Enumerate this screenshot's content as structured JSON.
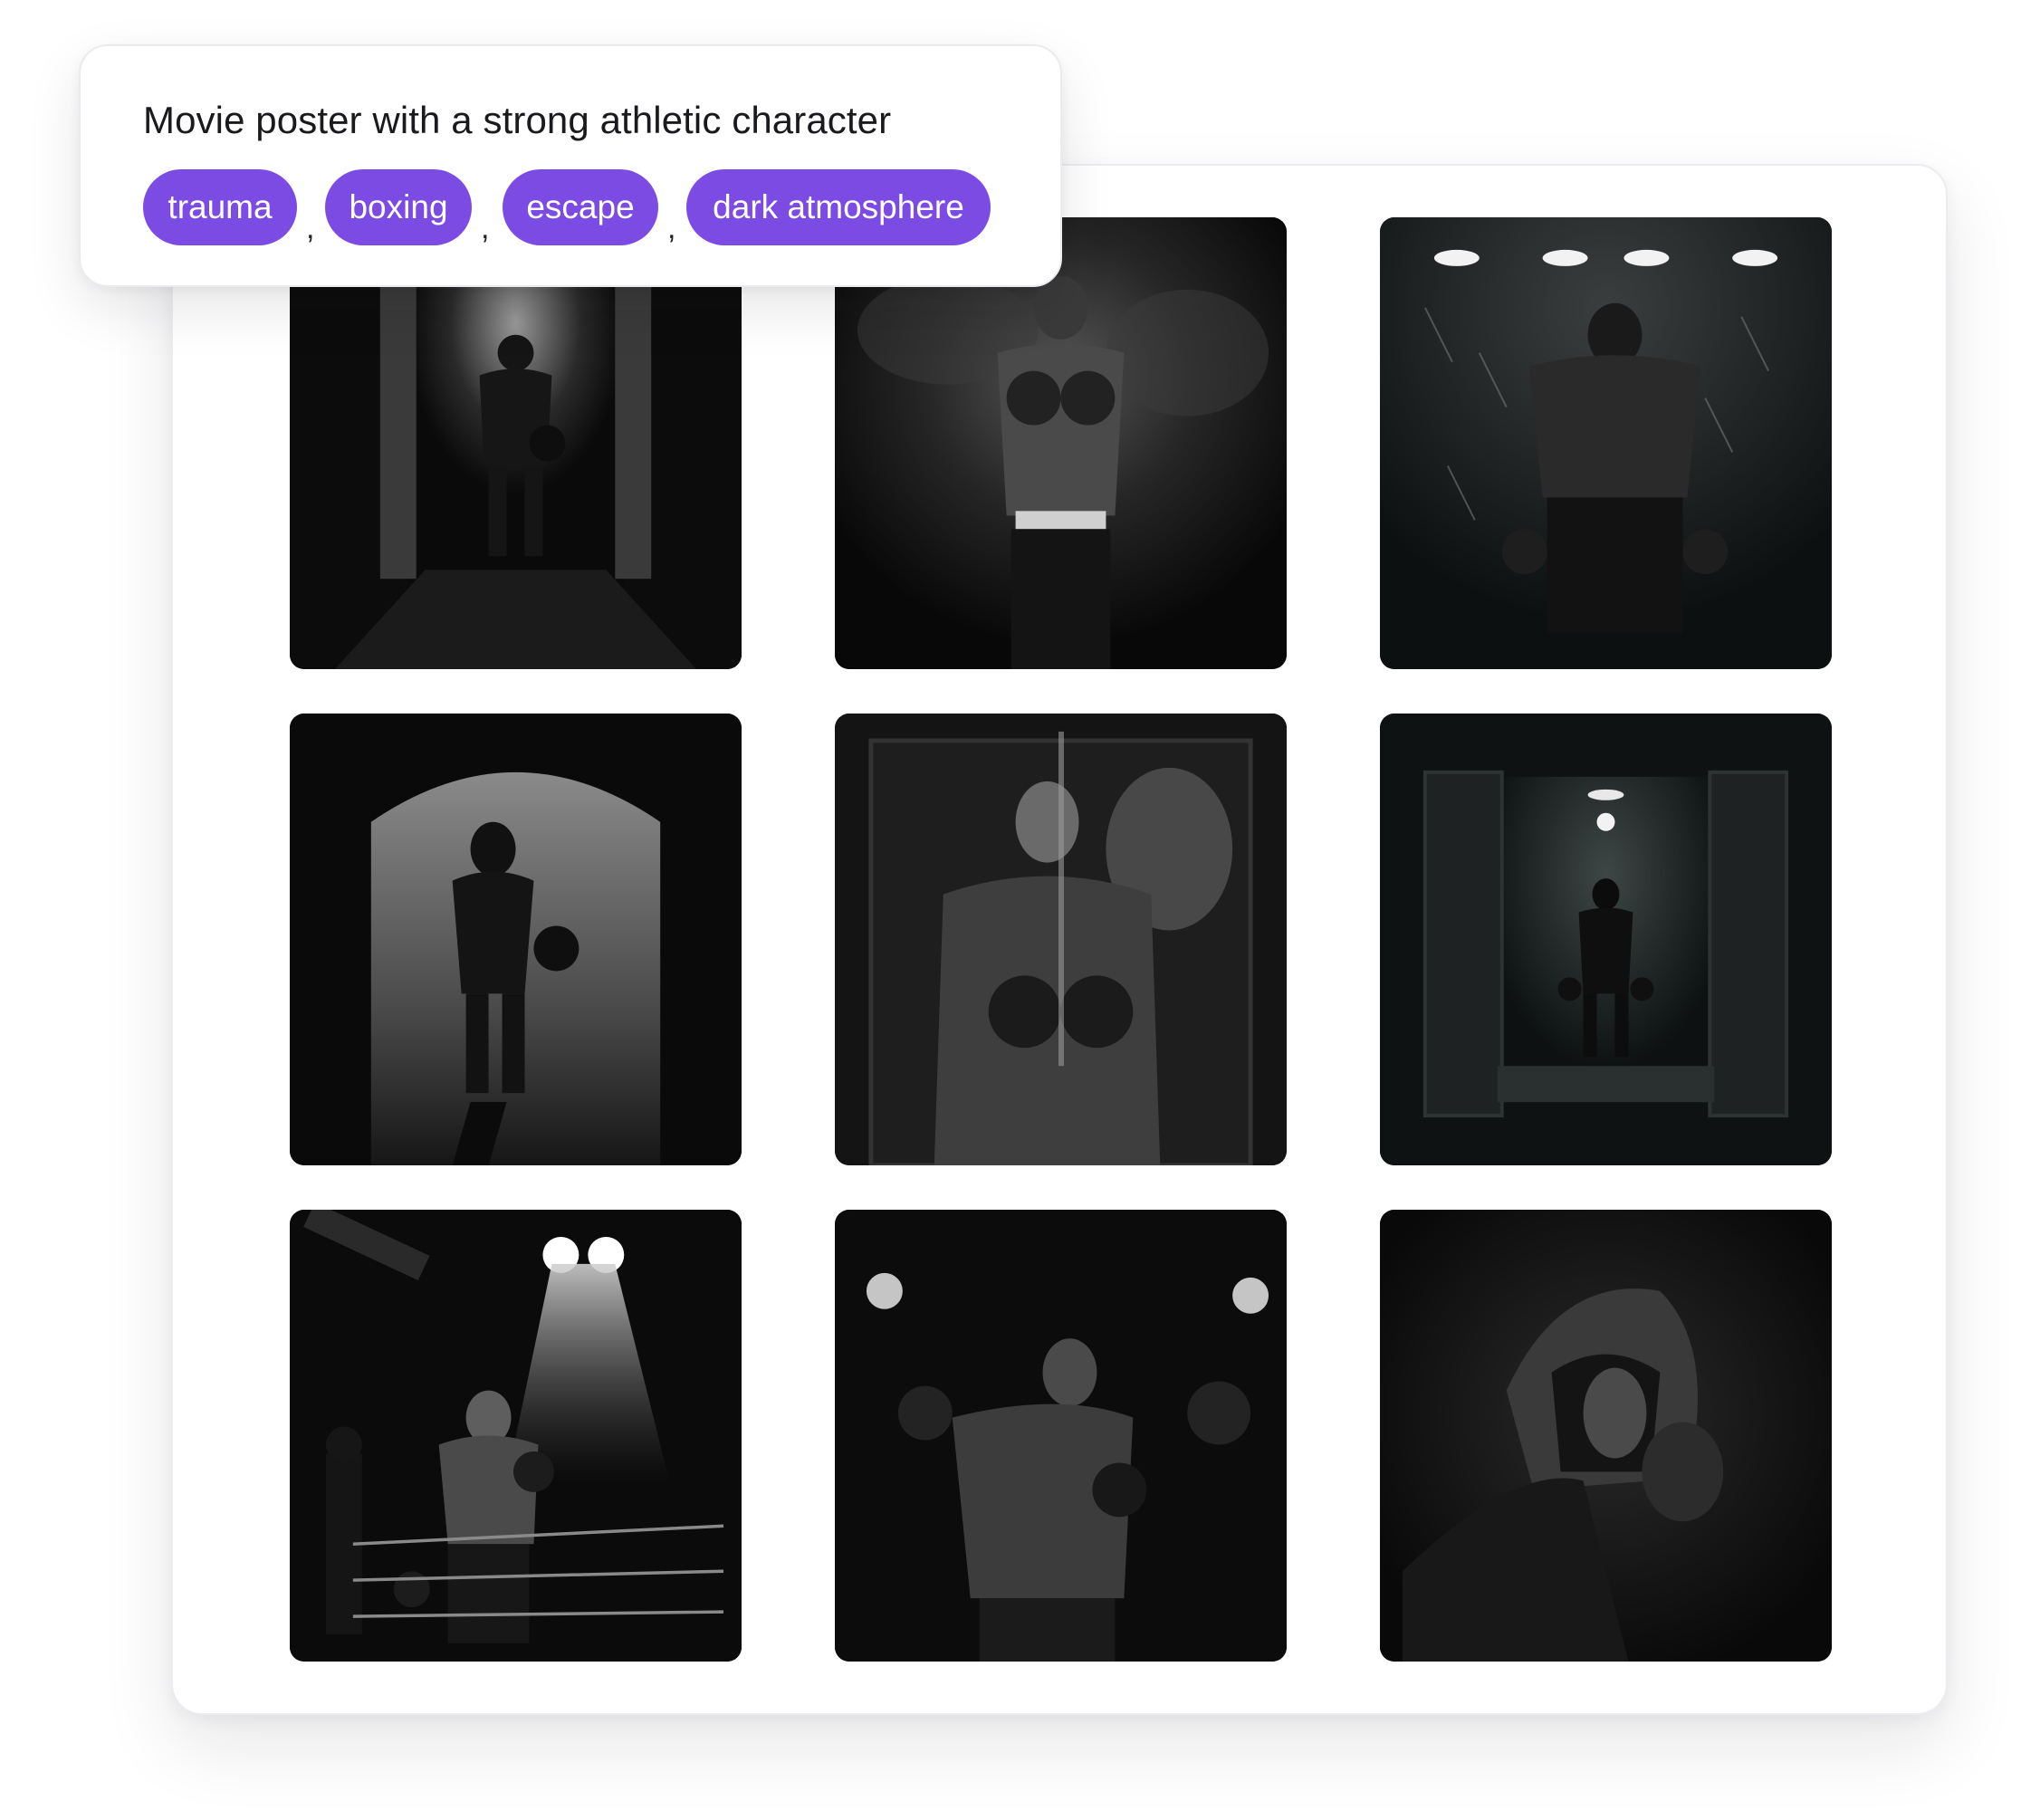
{
  "prompt": {
    "title": "Movie poster with a strong athletic character",
    "tags": [
      "trauma",
      "boxing",
      "escape",
      "dark atmosphere"
    ],
    "separator": ","
  },
  "colors": {
    "tag_background": "#7b4be3",
    "tag_text": "#ffffff",
    "tile_background": "#0b0b0c"
  },
  "gallery": {
    "images": [
      "boxer-standing-in-doorway-under-lamp",
      "boxer-front-view-smoke",
      "boxer-back-view-under-lights",
      "boxer-back-view-arched-doorway-rain",
      "boxer-double-exposure-face",
      "boxer-in-corridor-doorway",
      "boxer-in-ring-spotlight",
      "boxer-sweat-bokeh",
      "boxer-hooded-with-glove"
    ]
  }
}
